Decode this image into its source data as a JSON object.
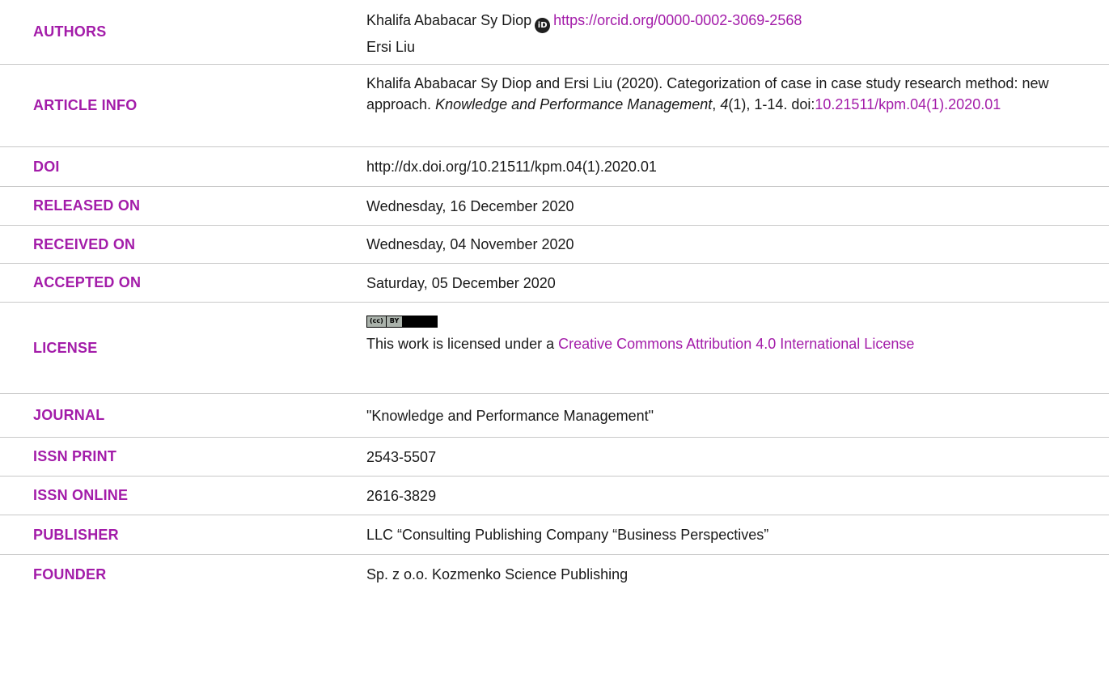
{
  "rows": {
    "authors": {
      "label": "AUTHORS",
      "author1_name": "Khalifa Ababacar Sy Diop",
      "orcid_icon": "orcid-icon",
      "orcid_link": "https://orcid.org/0000-0002-3069-2568",
      "author2_name": "Ersi Liu"
    },
    "article_info": {
      "label": "ARTICLE INFO",
      "citation_main": "Khalifa Ababacar Sy Diop and Ersi Liu (2020). Categorization of case in case study research method: new approach.",
      "journal_italic": "Knowledge and Performance Management",
      "comma1": ", ",
      "volume_italic": "4",
      "issue_pages": "(1), 1-14. doi:",
      "doi_link": "10.21511/kpm.04(1).2020.01"
    },
    "doi": {
      "label": "DOI",
      "value": "http://dx.doi.org/10.21511/kpm.04(1).2020.01"
    },
    "released_on": {
      "label": "RELEASED ON",
      "value": "Wednesday, 16 December 2020"
    },
    "received_on": {
      "label": "RECEIVED ON",
      "value": "Wednesday, 04 November 2020"
    },
    "accepted_on": {
      "label": "ACCEPTED ON",
      "value": "Saturday, 05 December 2020"
    },
    "license": {
      "label": "LICENSE",
      "badge_left": "(cc)",
      "badge_mid": "BY",
      "text": "This work is licensed under a ",
      "link": "Creative Commons Attribution 4.0 International License"
    },
    "journal": {
      "label": "JOURNAL",
      "value": "\"Knowledge and Performance Management\""
    },
    "issn_print": {
      "label": "ISSN PRINT",
      "value": "2543-5507"
    },
    "issn_online": {
      "label": "ISSN ONLINE",
      "value": "2616-3829"
    },
    "publisher": {
      "label": "PUBLISHER",
      "value": "LLC “Consulting Publishing Company “Business Perspectives”"
    },
    "founder": {
      "label": "FOUNDER",
      "value": "Sp. z o.o. Kozmenko Science Publishing"
    }
  },
  "colors": {
    "label_accent": "#a31ca9",
    "link": "#a31ca9",
    "divider": "#c9c9c9",
    "text": "#1a1a1a"
  }
}
